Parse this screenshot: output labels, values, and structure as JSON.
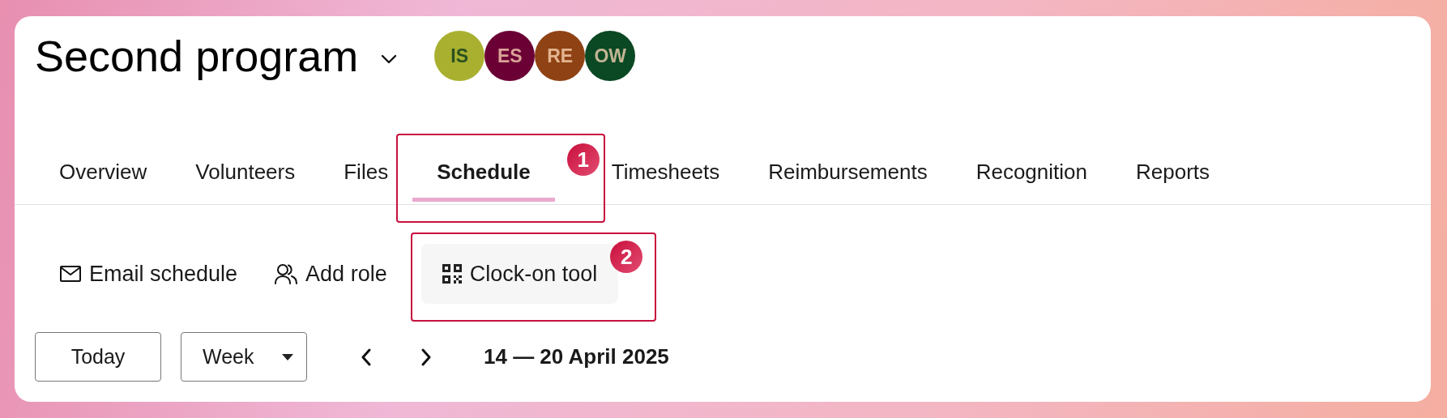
{
  "program": {
    "title": "Second program"
  },
  "members": [
    {
      "initials": "IS",
      "color": "#a9b030"
    },
    {
      "initials": "ES",
      "color": "#6b0035"
    },
    {
      "initials": "RE",
      "color": "#8f4214"
    },
    {
      "initials": "OW",
      "color": "#0b4824"
    }
  ],
  "tabs": [
    {
      "label": "Overview",
      "selected": false
    },
    {
      "label": "Volunteers",
      "selected": false
    },
    {
      "label": "Files",
      "selected": false
    },
    {
      "label": "Schedule",
      "selected": true,
      "annotation": "1"
    },
    {
      "label": "Timesheets",
      "selected": false
    },
    {
      "label": "Reimbursements",
      "selected": false
    },
    {
      "label": "Recognition",
      "selected": false
    },
    {
      "label": "Reports",
      "selected": false
    }
  ],
  "toolbar": [
    {
      "label": "Email schedule",
      "kind": "mail",
      "highlighted": false
    },
    {
      "label": "Add role",
      "kind": "people",
      "highlighted": false
    },
    {
      "label": "Clock-on tool",
      "kind": "qr",
      "highlighted": true,
      "annotation": "2"
    }
  ],
  "date_controls": {
    "today_button": "Today",
    "view_select": "Week",
    "range": "14 — 20 April 2025"
  }
}
